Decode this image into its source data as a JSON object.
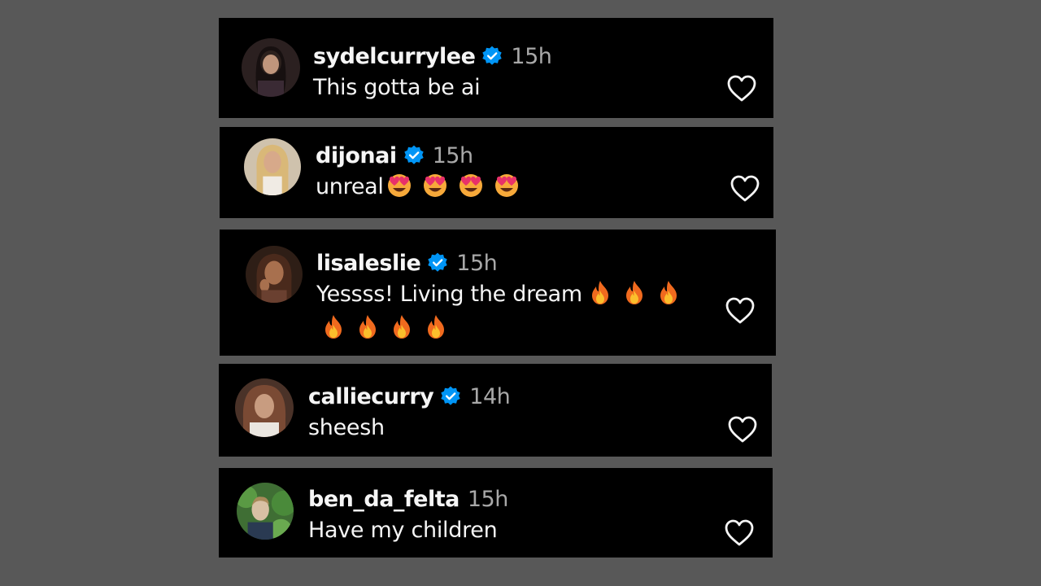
{
  "comments": [
    {
      "username": "sydelcurrylee",
      "verified": true,
      "time": "15h",
      "text": "This gotta be ai",
      "emoji": [],
      "avatar_colors": [
        "#3a2a2a",
        "#1a1414",
        "#b58a72"
      ]
    },
    {
      "username": "dijonai",
      "verified": true,
      "time": "15h",
      "text": "unreal",
      "emoji": [
        "heart-eyes",
        "heart-eyes",
        "heart-eyes",
        "heart-eyes"
      ],
      "avatar_colors": [
        "#d9c9b0",
        "#c8a878",
        "#e8dcc8"
      ]
    },
    {
      "username": "lisaleslie",
      "verified": true,
      "time": "15h",
      "text": "Yessss! Living the dream",
      "emoji": [
        "fire",
        "fire",
        "fire"
      ],
      "emoji_line2": [
        "fire",
        "fire",
        "fire",
        "fire"
      ],
      "avatar_colors": [
        "#5a3a2a",
        "#9a6a4a",
        "#2a1a14"
      ]
    },
    {
      "username": "calliecurry",
      "verified": true,
      "time": "14h",
      "text": "sheesh",
      "emoji": [],
      "avatar_colors": [
        "#6a4a3a",
        "#e8e0d8",
        "#3a2a20"
      ]
    },
    {
      "username": "ben_da_felta",
      "verified": false,
      "time": "15h",
      "text": "Have my children",
      "emoji": [],
      "avatar_colors": [
        "#4a7a3a",
        "#c8b8a0",
        "#2a3a4a"
      ]
    }
  ],
  "colors": {
    "background": "#585858",
    "card": "#000000",
    "verified_badge": "#0095f6",
    "timestamp": "#a8a8a8",
    "text": "#f5f5f5"
  }
}
